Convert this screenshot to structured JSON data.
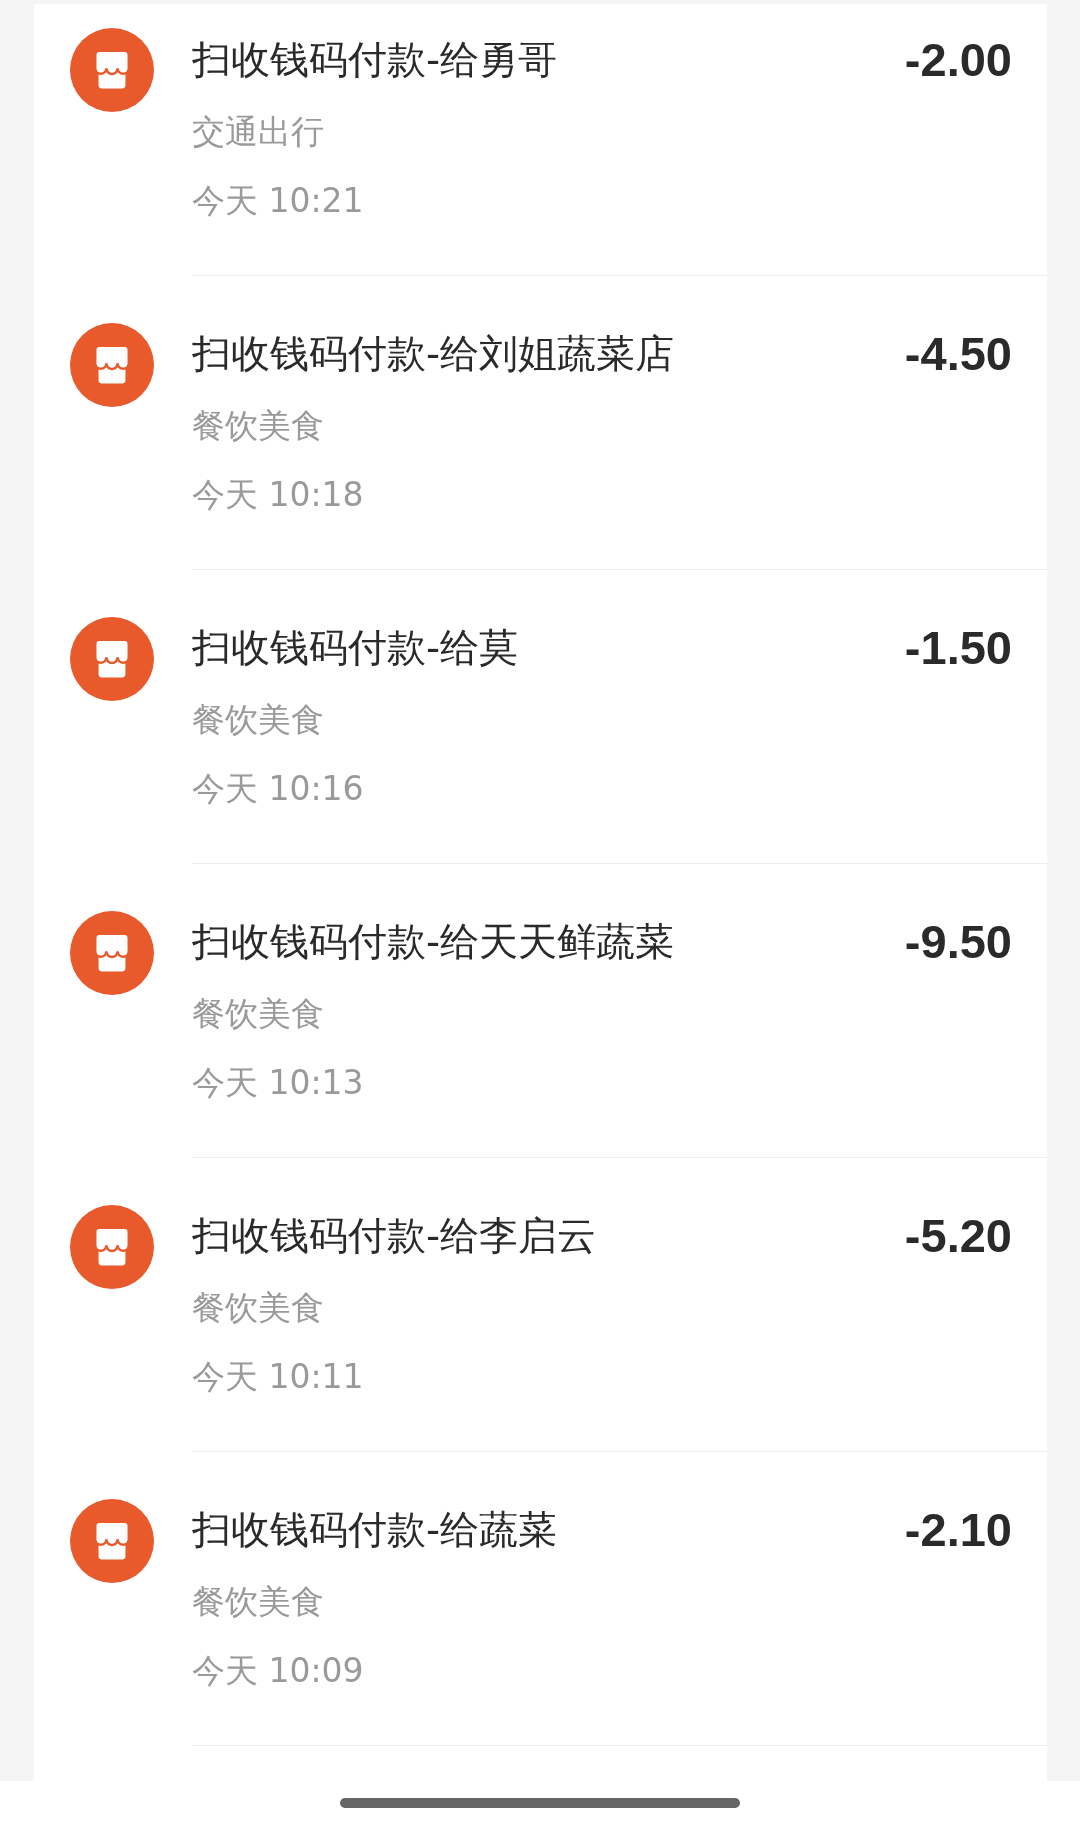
{
  "transactions": [
    {
      "title": "扫收钱码付款-给勇哥",
      "category": "交通出行",
      "time": "今天 10:21",
      "amount": "-2.00"
    },
    {
      "title": "扫收钱码付款-给刘姐蔬菜店",
      "category": "餐饮美食",
      "time": "今天 10:18",
      "amount": "-4.50"
    },
    {
      "title": "扫收钱码付款-给莫",
      "category": "餐饮美食",
      "time": "今天 10:16",
      "amount": "-1.50"
    },
    {
      "title": "扫收钱码付款-给天天鲜蔬菜",
      "category": "餐饮美食",
      "time": "今天 10:13",
      "amount": "-9.50"
    },
    {
      "title": "扫收钱码付款-给李启云",
      "category": "餐饮美食",
      "time": "今天 10:11",
      "amount": "-5.20"
    },
    {
      "title": "扫收钱码付款-给蔬菜",
      "category": "餐饮美食",
      "time": "今天 10:09",
      "amount": "-2.10"
    }
  ]
}
